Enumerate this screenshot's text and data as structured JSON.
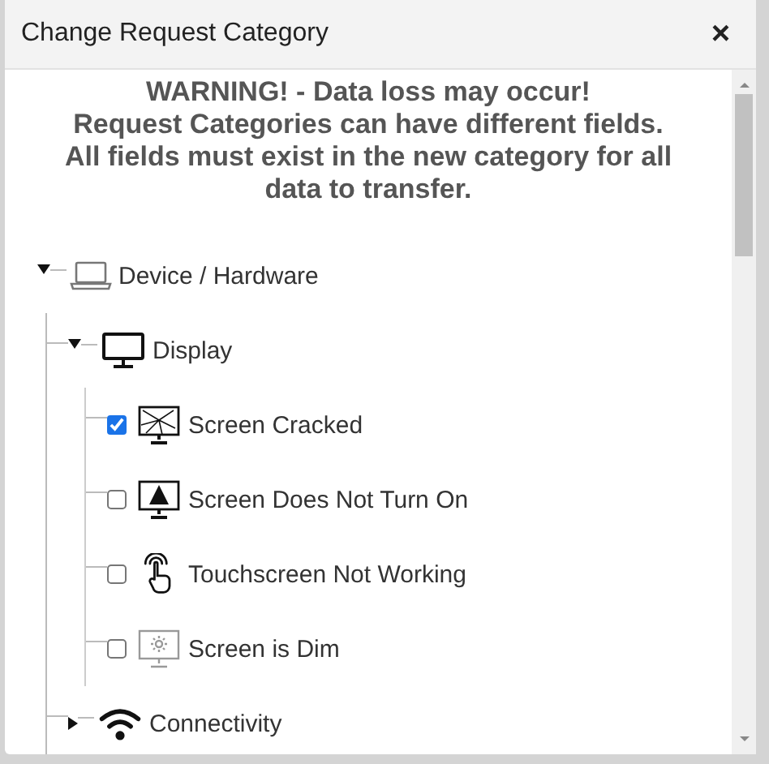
{
  "dialog": {
    "title": "Change Request Category",
    "close": "×"
  },
  "warning": {
    "headline": "WARNING! - Data loss may occur!",
    "text": "Request Categories can have different fields. All fields must exist in the new category for all data to transfer."
  },
  "tree": [
    {
      "label": "Device / Hardware",
      "expanded": true,
      "children": [
        {
          "label": "Display",
          "expanded": true,
          "children": [
            {
              "label": "Screen Cracked",
              "checked": true
            },
            {
              "label": "Screen Does Not Turn On",
              "checked": false
            },
            {
              "label": "Touchscreen Not Working",
              "checked": false
            },
            {
              "label": "Screen is Dim",
              "checked": false
            }
          ]
        },
        {
          "label": "Connectivity",
          "expanded": false
        }
      ]
    }
  ]
}
